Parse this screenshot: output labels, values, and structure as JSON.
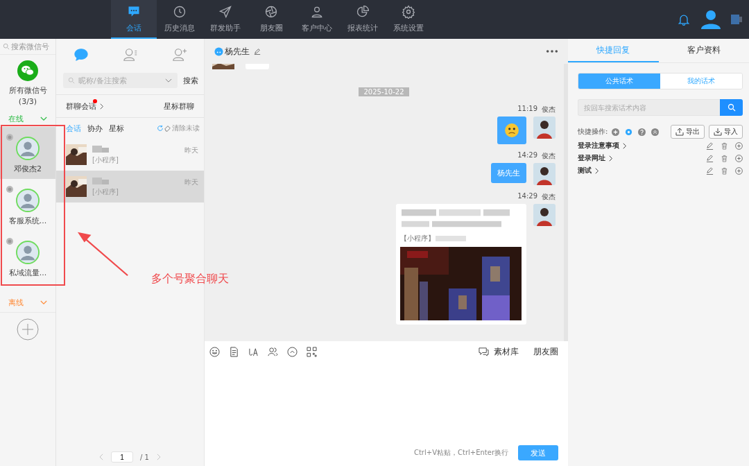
{
  "nav": {
    "tabs": [
      {
        "label": "会话",
        "selected": true
      },
      {
        "label": "历史消息",
        "selected": false
      },
      {
        "label": "群发助手",
        "selected": false
      },
      {
        "label": "朋友圈",
        "selected": false
      },
      {
        "label": "客户中心",
        "selected": false
      },
      {
        "label": "报表统计",
        "selected": false
      },
      {
        "label": "系统设置",
        "selected": false
      }
    ]
  },
  "accounts": {
    "search_placeholder": "搜索微信号",
    "all_label": "所有微信号",
    "all_count": "(3/3)",
    "groups": [
      {
        "label": "在线",
        "color": "#2dbb45"
      },
      {
        "label": "离线",
        "color": "#ff8c3a"
      }
    ],
    "items": [
      {
        "name": "邓俊杰2",
        "selected": true
      },
      {
        "name": "客服系统...",
        "selected": false
      },
      {
        "name": "私域流量...",
        "selected": false
      }
    ]
  },
  "contacts": {
    "icon_tabs": [
      {
        "selected": true
      },
      {
        "selected": false
      },
      {
        "selected": false
      }
    ],
    "search_placeholder": "昵称/备注搜索",
    "search_button": "搜索",
    "group_chat": {
      "label": "群聊会话",
      "unread": true
    },
    "starred_groups": "星标群聊",
    "sub_tabs": [
      {
        "label": "会话",
        "selected": true
      },
      {
        "label": "协办",
        "selected": false
      },
      {
        "label": "星标",
        "selected": false
      }
    ],
    "clear_unread": "清除未读",
    "rows": [
      {
        "preview": "[小程序]",
        "time": "昨天",
        "selected": false
      },
      {
        "preview": "[小程序]",
        "time": "昨天",
        "selected": true
      }
    ],
    "pagination": {
      "page": "1",
      "total": "/ 1"
    }
  },
  "chat": {
    "title": "杨先生",
    "date": "2025-10-22",
    "messages": [
      {
        "kind": "emoji",
        "time": "11:19",
        "sender": "俊杰"
      },
      {
        "kind": "text",
        "time": "14:29",
        "sender": "俊杰",
        "text": "杨先生"
      },
      {
        "kind": "card",
        "time": "14:29",
        "sender": "俊杰",
        "label": "【小程序】"
      }
    ],
    "tools": [
      "素材库",
      "朋友圈"
    ],
    "hint": "Ctrl+V粘贴，Ctrl+Enter换行",
    "send": "发送"
  },
  "quick": {
    "tabs": [
      {
        "label": "快捷回复",
        "selected": true
      },
      {
        "label": "客户资料",
        "selected": false
      }
    ],
    "segments": [
      {
        "label": "公共话术",
        "selected": true
      },
      {
        "label": "我的话术",
        "selected": false
      }
    ],
    "search_placeholder": "按回车搜索话术内容",
    "actions_label": "快捷操作:",
    "export": "导出",
    "import": "导入",
    "categories": [
      "登录注意事项",
      "登录网址",
      "测试"
    ]
  },
  "annotation": "多个号聚合聊天"
}
